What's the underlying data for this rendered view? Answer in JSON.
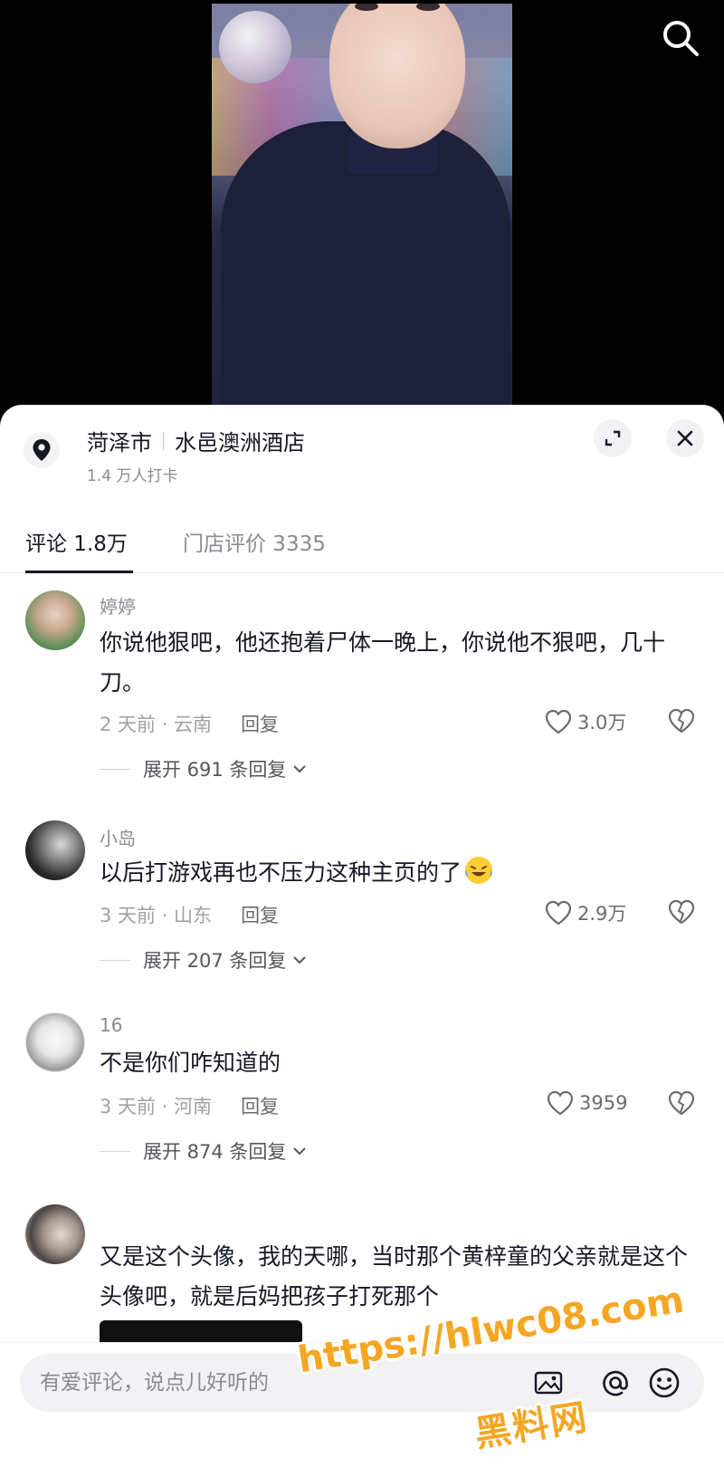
{
  "location": {
    "city": "菏泽市",
    "venue": "水邑澳洲酒店",
    "checkins": "1.4 万人打卡"
  },
  "tabs": [
    {
      "label": "评论 1.8万"
    },
    {
      "label": "门店评价 3335"
    }
  ],
  "comments": [
    {
      "user": "婷婷",
      "text": "你说他狠吧，他还抱着尸体一晚上，你说他不狠吧，几十刀。",
      "time_location": "2 天前 · 云南",
      "reply_label": "回复",
      "likes": "3.0万",
      "expand_label": "展开 691 条回复"
    },
    {
      "user": "小岛",
      "text": "以后打游戏再也不压力这种主页的了",
      "time_location": "3 天前 · 山东",
      "reply_label": "回复",
      "likes": "2.9万",
      "expand_label": "展开 207 条回复"
    },
    {
      "user": "16",
      "text": "不是你们咋知道的",
      "time_location": "3 天前 · 河南",
      "reply_label": "回复",
      "likes": "3959",
      "expand_label": "展开 874 条回复"
    },
    {
      "user": "",
      "text": "又是这个头像，我的天哪，当时那个黄梓童的父亲就是这个头像吧，就是后妈把孩子打死那个"
    }
  ],
  "input": {
    "placeholder": "有爱评论，说点儿好听的"
  },
  "watermark": {
    "url": "https://hlwc08.com",
    "site": "黑料网"
  }
}
